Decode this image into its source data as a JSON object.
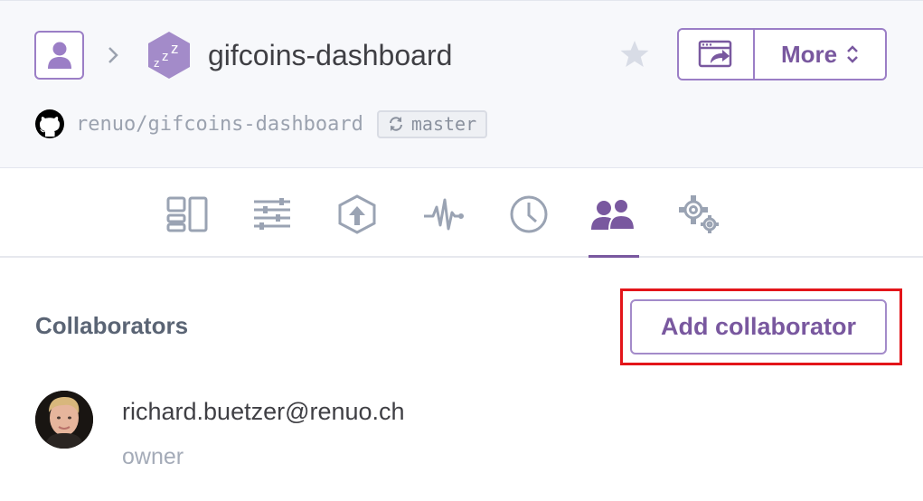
{
  "header": {
    "app_name": "gifcoins-dashboard",
    "repo": "renuo/gifcoins-dashboard",
    "branch": "master",
    "more_label": "More"
  },
  "nav": {
    "items": [
      "overview-icon",
      "resources-icon",
      "deploy-icon",
      "metrics-icon",
      "activity-icon",
      "access-icon",
      "settings-icon"
    ],
    "active": "access"
  },
  "collaborators": {
    "title": "Collaborators",
    "add_button_label": "Add collaborator",
    "list": [
      {
        "email": "richard.buetzer@renuo.ch",
        "role": "owner"
      }
    ]
  },
  "colors": {
    "accent": "#79589f",
    "nav_icon": "#9aa3b3",
    "highlight": "#e3151a"
  }
}
